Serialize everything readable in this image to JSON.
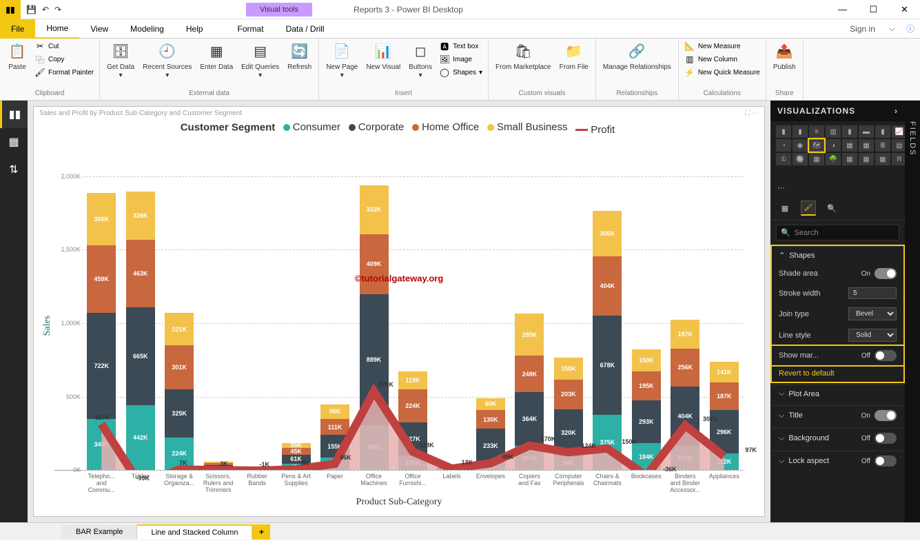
{
  "window": {
    "title": "Reports 3 - Power BI Desktop",
    "visual_tools": "Visual tools",
    "signin": "Sign in",
    "min": "—",
    "max": "☐",
    "close": "✕"
  },
  "tabs": {
    "file": "File",
    "home": "Home",
    "view": "View",
    "modeling": "Modeling",
    "help": "Help",
    "format": "Format",
    "datadrill": "Data / Drill"
  },
  "ribbon": {
    "clipboard": {
      "label": "Clipboard",
      "paste": "Paste",
      "cut": "Cut",
      "copy": "Copy",
      "painter": "Format Painter"
    },
    "external": {
      "label": "External data",
      "getdata": "Get Data",
      "recent": "Recent Sources",
      "enter": "Enter Data",
      "edit": "Edit Queries",
      "refresh": "Refresh"
    },
    "insert": {
      "label": "Insert",
      "newpage": "New Page",
      "newvisual": "New Visual",
      "buttons": "Buttons",
      "textbox": "Text box",
      "image": "Image",
      "shapes": "Shapes"
    },
    "custom": {
      "label": "Custom visuals",
      "market": "From Marketplace",
      "file": "From File"
    },
    "relationships": {
      "label": "Relationships",
      "manage": "Manage Relationships"
    },
    "calc": {
      "label": "Calculations",
      "measure": "New Measure",
      "column": "New Column",
      "quick": "New Quick Measure"
    },
    "share": {
      "label": "Share",
      "publish": "Publish"
    }
  },
  "chart": {
    "title": "Sales and Profit by Product Sub-Category and Customer Segment",
    "legend_title": "Customer Segment",
    "segments": [
      "Consumer",
      "Corporate",
      "Home Office",
      "Small Business",
      "Profit"
    ],
    "colors": {
      "Consumer": "#2db0a6",
      "Corporate": "#3b4a55",
      "Home Office": "#c9673e",
      "Small Business": "#f2c24b",
      "Profit": "#c04040",
      "ProfitFill": "#e7b0b0"
    },
    "ylabel": "Sales",
    "xlabel": "Product Sub-Category",
    "watermark": "©tutorialgateway.org",
    "ylim": [
      0,
      2250
    ],
    "yticks": [
      0,
      500,
      1000,
      1500,
      2000
    ],
    "yticklabels": [
      "0K",
      "500K",
      "1,000K",
      "1,500K",
      "2,000K"
    ]
  },
  "chart_data": {
    "type": "stacked-bar+line",
    "categories": [
      "Telepho... and Commu...",
      "Tables",
      "Storage & Organiza...",
      "Scissors, Rulers and Trimmers",
      "Rubber Bands",
      "Pens & Art Supplies",
      "Paper",
      "Office Machines",
      "Office Furnishi...",
      "Labels",
      "Envelopes",
      "Copiers and Fax",
      "Computer Peripherals",
      "Chairs & Chairmats",
      "Bookcases",
      "Binders and Binder Accessor...",
      "Appliances"
    ],
    "series": [
      {
        "name": "Consumer",
        "values": [
          348,
          442,
          224,
          15,
          4,
          45,
          84,
          308,
          100,
          6,
          48,
          167,
          94,
          375,
          184,
          167,
          112
        ]
      },
      {
        "name": "Corporate",
        "values": [
          722,
          665,
          325,
          20,
          8,
          61,
          155,
          889,
          227,
          10,
          233,
          364,
          320,
          678,
          293,
          404,
          296
        ]
      },
      {
        "name": "Home Office",
        "values": [
          459,
          463,
          301,
          12,
          4,
          45,
          111,
          409,
          224,
          6,
          130,
          248,
          203,
          404,
          195,
          256,
          187
        ]
      },
      {
        "name": "Small Business",
        "values": [
          360,
          326,
          221,
          10,
          4,
          35,
          96,
          332,
          119,
          5,
          80,
          285,
          150,
          306,
          150,
          197,
          141
        ]
      }
    ],
    "line": {
      "name": "Profit",
      "values": [
        317,
        -99,
        7,
        3,
        -1,
        8,
        46,
        539,
        128,
        13,
        49,
        170,
        124,
        150,
        -36,
        307,
        97
      ]
    }
  },
  "vizpane": {
    "title": "VISUALIZATIONS",
    "search_placeholder": "Search",
    "shapes": {
      "title": "Shapes",
      "shade": "Shade area",
      "shade_val": "On",
      "stroke": "Stroke width",
      "stroke_val": "5",
      "join": "Join type",
      "join_val": "Bevel",
      "linestyle": "Line style",
      "linestyle_val": "Solid",
      "marker": "Show mar...",
      "marker_val": "Off"
    },
    "revert": "Revert to default",
    "plotarea": "Plot Area",
    "titleprop": {
      "label": "Title",
      "val": "On"
    },
    "bg": {
      "label": "Background",
      "val": "Off"
    },
    "lock": {
      "label": "Lock aspect",
      "val": "Off"
    }
  },
  "fields": {
    "label": "FIELDS"
  },
  "pages": {
    "bar": "BAR Example",
    "line": "Line and Stacked Column",
    "add": "+"
  }
}
